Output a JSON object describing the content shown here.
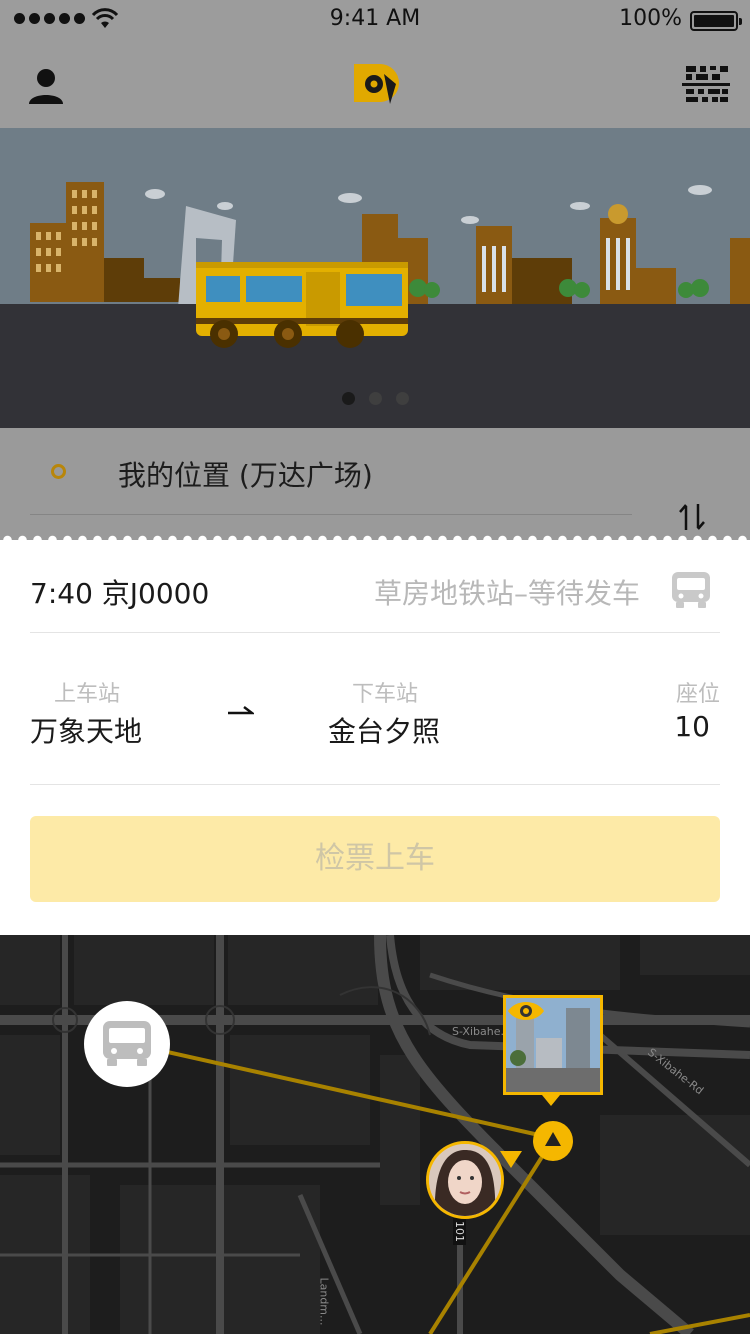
{
  "status_bar": {
    "time": "9:41 AM",
    "battery": "100%"
  },
  "location": {
    "text": "我的位置 (万达广场)"
  },
  "trip": {
    "header": "7:40 京J0000",
    "status": "草房地铁站–等待发车",
    "board_label": "上车站",
    "board_value": "万象天地",
    "alight_label": "下车站",
    "alight_value": "金台夕照",
    "seat_label": "座位",
    "seat_value": "10"
  },
  "check_button": {
    "label": "检票上车"
  },
  "map": {
    "road_labels": [
      "S-Xibahe...",
      "S-Xibahe-Rd",
      "101",
      "Landm..."
    ]
  },
  "banner": {
    "dots": 3,
    "active_dot": 0
  },
  "colors": {
    "accent": "#f5b700",
    "button_bg": "#fdeaa7"
  }
}
